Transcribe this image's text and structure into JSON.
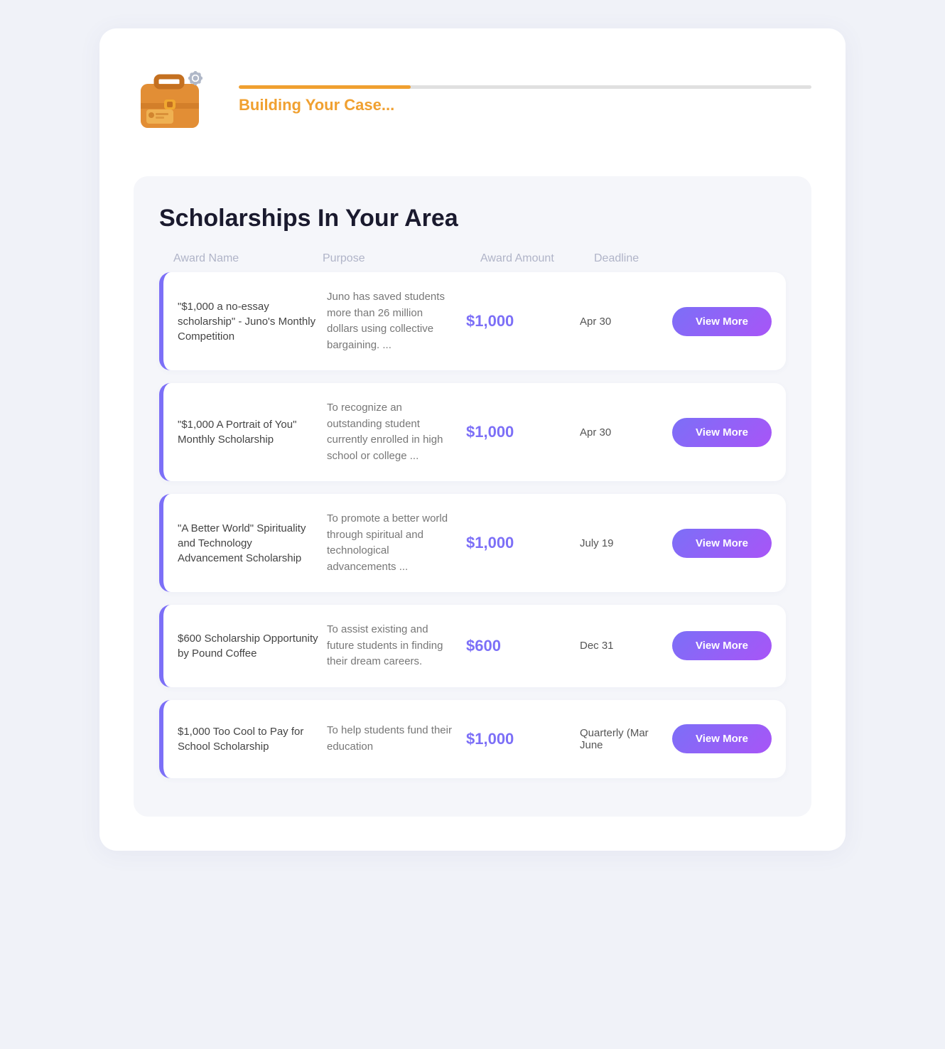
{
  "header": {
    "progress_percent": 30,
    "building_label": "Building Your Case...",
    "progress_bar_color": "#f0a030"
  },
  "section": {
    "title": "Scholarships In Your Area"
  },
  "table": {
    "columns": [
      "Award Name",
      "Purpose",
      "Award Amount",
      "Deadline",
      ""
    ],
    "rows": [
      {
        "award_name": "\"$1,000 a no-essay scholarship\" - Juno's Monthly Competition",
        "purpose": "Juno has saved students more than 26 million dollars using collective bargaining. ...",
        "amount": "$1,000",
        "deadline": "Apr 30",
        "btn_label": "View More"
      },
      {
        "award_name": "\"$1,000 A Portrait of You\" Monthly Scholarship",
        "purpose": "To recognize an outstanding student currently enrolled in high school or college ...",
        "amount": "$1,000",
        "deadline": "Apr 30",
        "btn_label": "View More"
      },
      {
        "award_name": "\"A Better World\" Spirituality and Technology Advancement Scholarship",
        "purpose": "To promote a better world through spiritual and technological advancements ...",
        "amount": "$1,000",
        "deadline": "July 19",
        "btn_label": "View More"
      },
      {
        "award_name": "$600 Scholarship Opportunity by Pound Coffee",
        "purpose": "To assist existing and future students in finding their dream careers.",
        "amount": "$600",
        "deadline": "Dec 31",
        "btn_label": "View More"
      },
      {
        "award_name": "$1,000 Too Cool to Pay for School Scholarship",
        "purpose": "To help students fund their education",
        "amount": "$1,000",
        "deadline": "Quarterly (Mar\nJune",
        "btn_label": "View More"
      }
    ]
  },
  "col_labels": {
    "award_name": "Award Name",
    "purpose": "Purpose",
    "award_amount": "Award Amount",
    "deadline": "Deadline"
  }
}
